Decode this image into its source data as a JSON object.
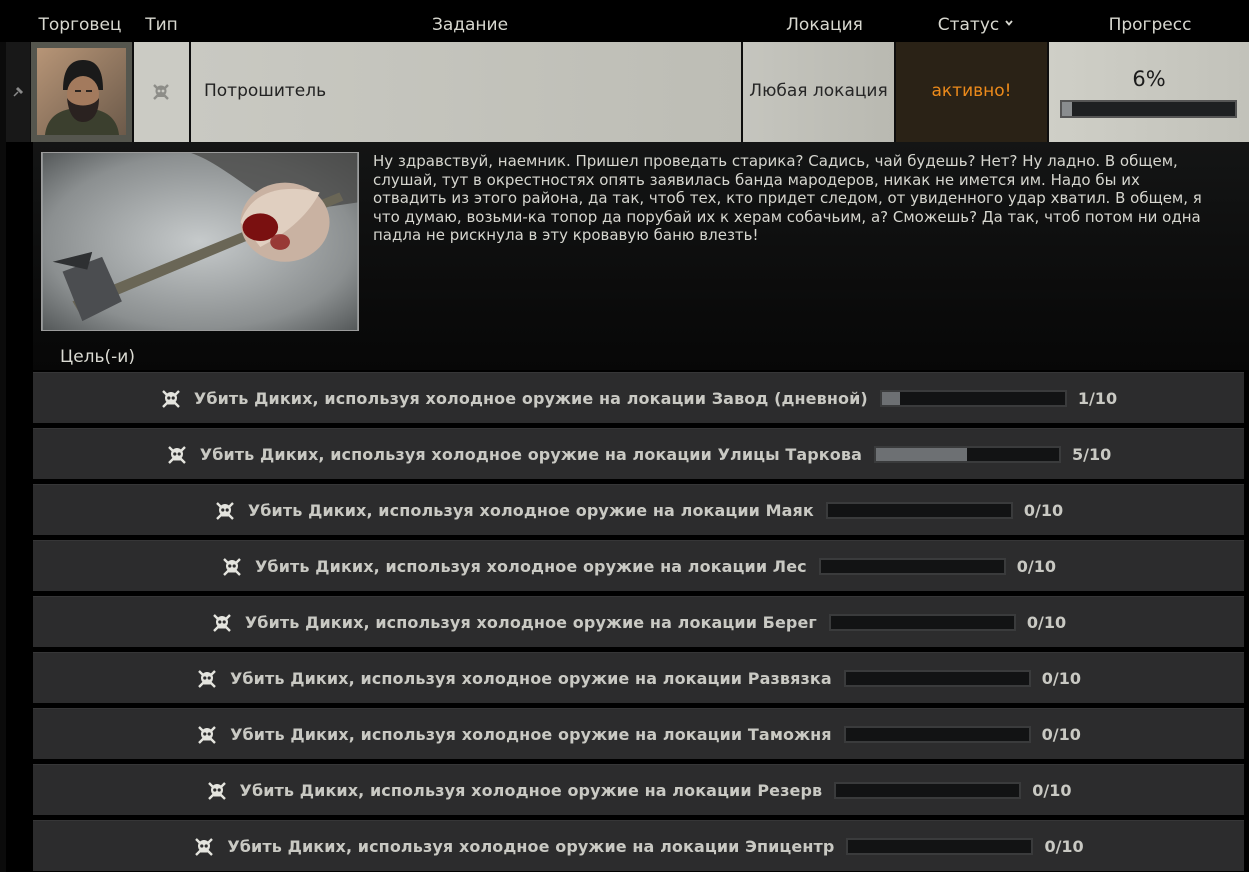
{
  "header": {
    "trader": "Торговец",
    "type": "Тип",
    "quest": "Задание",
    "location": "Локация",
    "status": "Статус",
    "progress": "Прогресс"
  },
  "task": {
    "trader_avatar": "trader-portrait",
    "type_icon": "skull-crossbones-icon",
    "name": "Потрошитель",
    "location": "Любая локация",
    "status": "активно!",
    "progress_text": "6%",
    "progress_fraction": 0.06
  },
  "details": {
    "image": "bloody-hand-holding-axe",
    "description": "Ну здравствуй, наемник. Пришел проведать старика? Садись, чай будешь? Нет? Ну ладно. В общем, слушай, тут в окрестностях опять заявилась банда мародеров, никак не имется им. Надо бы их отвадить из этого района, да так, чтоб тех, кто придет следом, от увиденного удар хватил. В общем, я что думаю, возьми-ка топор да порубай их к херам собачьим, а? Сможешь? Да так, чтоб потом ни одна падла не рискнула в эту кровавую баню влезть!",
    "goals_title": "Цель(-и)"
  },
  "objectives": [
    {
      "text": "Убить Диких, используя холодное оружие на локации Завод (дневной)",
      "count": "1/10",
      "fraction": 0.1
    },
    {
      "text": "Убить Диких, используя холодное оружие на локации Улицы Таркова",
      "count": "5/10",
      "fraction": 0.5
    },
    {
      "text": "Убить Диких, используя холодное оружие на локации Маяк",
      "count": "0/10",
      "fraction": 0
    },
    {
      "text": "Убить Диких, используя холодное оружие на локации Лес",
      "count": "0/10",
      "fraction": 0
    },
    {
      "text": "Убить Диких, используя холодное оружие на локации Берег",
      "count": "0/10",
      "fraction": 0
    },
    {
      "text": "Убить Диких, используя холодное оружие на локации Развязка",
      "count": "0/10",
      "fraction": 0
    },
    {
      "text": "Убить Диких, используя холодное оружие на локации Таможня",
      "count": "0/10",
      "fraction": 0
    },
    {
      "text": "Убить Диких, используя холодное оружие на локации Резерв",
      "count": "0/10",
      "fraction": 0
    },
    {
      "text": "Убить Диких, используя холодное оружие на локации Эпицентр",
      "count": "0/10",
      "fraction": 0
    }
  ]
}
